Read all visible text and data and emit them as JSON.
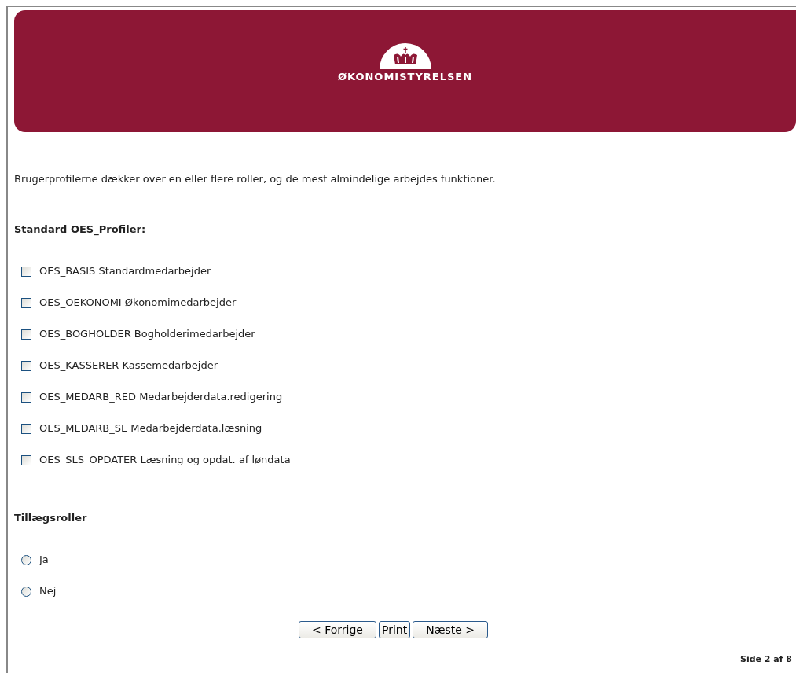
{
  "header": {
    "logo_text": "ØKONOMISTYRELSEN"
  },
  "intro": "Brugerprofilerne dækker over en eller flere roller, og de mest almindelige arbejdes funktioner.",
  "profiles": {
    "heading": "Standard OES_Profiler:",
    "items": [
      {
        "label": "OES_BASIS Standardmedarbejder",
        "checked": false
      },
      {
        "label": "OES_OEKONOMI Økonomimedarbejder",
        "checked": false
      },
      {
        "label": "OES_BOGHOLDER Bogholderimedarbejder",
        "checked": false
      },
      {
        "label": "OES_KASSERER Kassemedarbejder",
        "checked": false
      },
      {
        "label": "OES_MEDARB_RED Medarbejderdata.redigering",
        "checked": false
      },
      {
        "label": "OES_MEDARB_SE Medarbejderdata.læsning",
        "checked": false
      },
      {
        "label": "OES_SLS_OPDATER Læsning og opdat. af løndata",
        "checked": false
      }
    ]
  },
  "extra_roles": {
    "heading": "Tillægsroller",
    "options": [
      {
        "label": "Ja",
        "selected": false
      },
      {
        "label": "Nej",
        "selected": false
      }
    ]
  },
  "buttons": [
    "< Forrige",
    "Print",
    "Næste >"
  ],
  "page_indicator": "Side 2 af 8"
}
